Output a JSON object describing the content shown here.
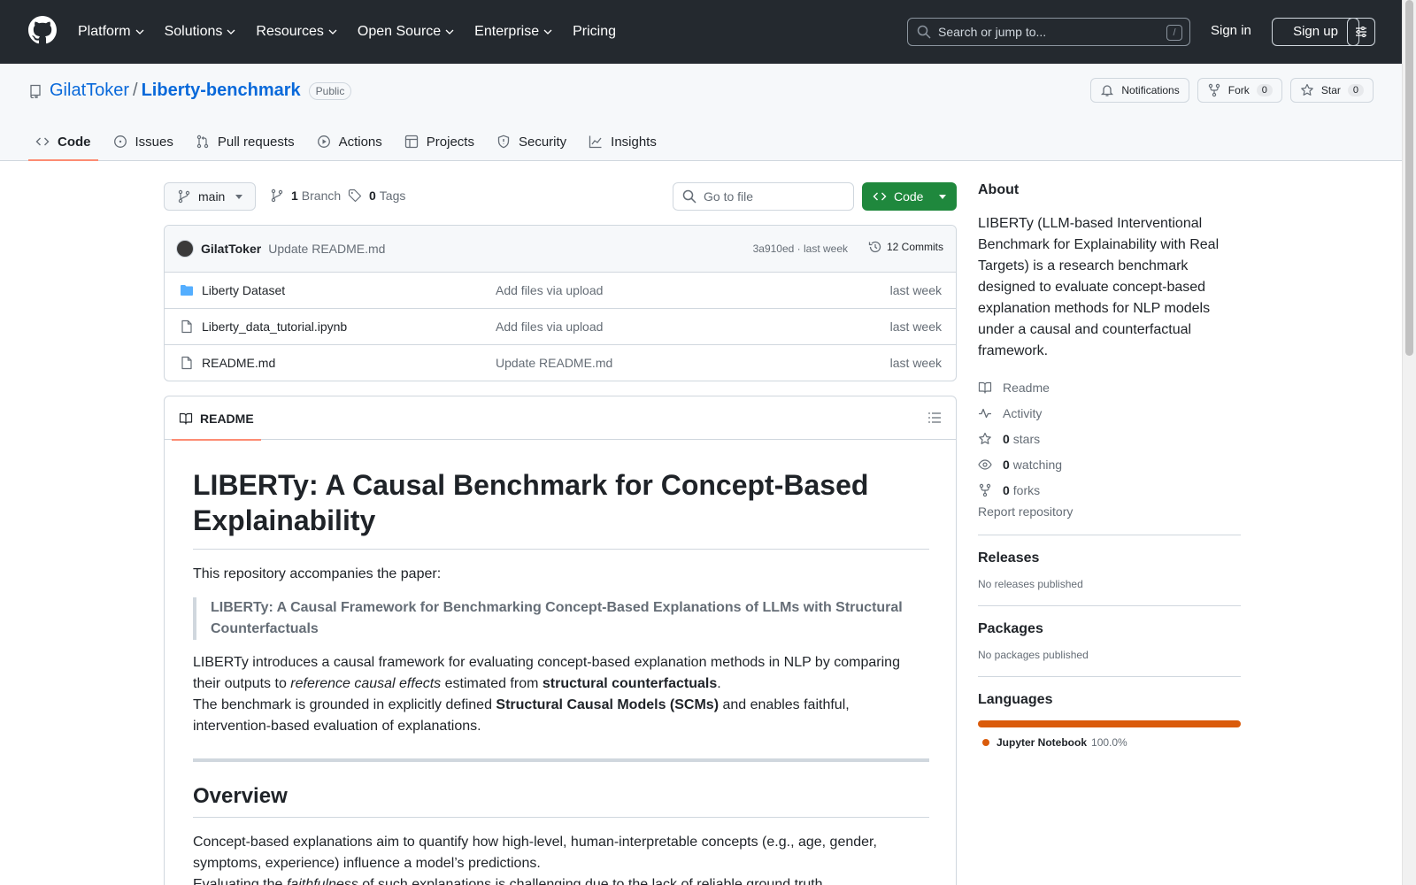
{
  "header": {
    "nav": [
      {
        "label": "Platform"
      },
      {
        "label": "Solutions"
      },
      {
        "label": "Resources"
      },
      {
        "label": "Open Source"
      },
      {
        "label": "Enterprise"
      },
      {
        "label": "Pricing"
      }
    ],
    "search_placeholder": "Search or jump to...",
    "search_shortcut": "/",
    "sign_in": "Sign in",
    "sign_up": "Sign up"
  },
  "repo": {
    "owner": "GilatToker",
    "separator": "/",
    "name": "Liberty-benchmark",
    "visibility": "Public",
    "notifications_label": "Notifications",
    "fork_label": "Fork",
    "fork_count": "0",
    "star_label": "Star",
    "star_count": "0",
    "tabs": [
      {
        "label": "Code"
      },
      {
        "label": "Issues"
      },
      {
        "label": "Pull requests"
      },
      {
        "label": "Actions"
      },
      {
        "label": "Projects"
      },
      {
        "label": "Security"
      },
      {
        "label": "Insights"
      }
    ]
  },
  "toolbar": {
    "branch": "main",
    "branch_count": "1",
    "branch_label": "Branch",
    "tag_count": "0",
    "tag_label": "Tags",
    "goto_placeholder": "Go to file",
    "code_label": "Code"
  },
  "commit": {
    "author": "GilatToker",
    "message": "Update README.md",
    "meta": "3a910ed · last week",
    "count_label": "12 Commits"
  },
  "files": [
    {
      "name": "Liberty Dataset",
      "message": "Add files via upload",
      "date": "last week",
      "type": "folder"
    },
    {
      "name": "Liberty_data_tutorial.ipynb",
      "message": "Add files via upload",
      "date": "last week",
      "type": "file"
    },
    {
      "name": "README.md",
      "message": "Update README.md",
      "date": "last week",
      "type": "file"
    }
  ],
  "readme": {
    "tab_label": "README",
    "title": "LIBERTy: A Causal Benchmark for Concept-Based Explainability",
    "intro": "This repository accompanies the paper:",
    "quote": "LIBERTy: A Causal Framework for Benchmarking Concept-Based Explanations of LLMs with Structural Counterfactuals",
    "p1_a": "LIBERTy introduces a causal framework for evaluating concept-based explanation methods in NLP by comparing their outputs to ",
    "p1_em": "reference causal effects",
    "p1_b": " estimated from ",
    "p1_strong": "structural counterfactuals",
    "p1_c": ".",
    "p2_a": "The benchmark is grounded in explicitly defined ",
    "p2_strong": "Structural Causal Models (SCMs)",
    "p2_b": " and enables faithful, intervention-based evaluation of explanations.",
    "h2": "Overview",
    "p3": "Concept-based explanations aim to quantify how high-level, human-interpretable concepts (e.g., age, gender, symptoms, experience) influence a model’s predictions.",
    "p4_a": "Evaluating the ",
    "p4_em": "faithfulness",
    "p4_b": " of such explanations is challenging due to the lack of reliable ground truth."
  },
  "sidebar": {
    "about_title": "About",
    "description": "LIBERTy (LLM-based Interventional Benchmark for Explainability with Real Targets) is a research benchmark designed to evaluate concept-based explanation methods for NLP models under a causal and counterfactual framework.",
    "readme_link": "Readme",
    "activity_link": "Activity",
    "stars_count": "0",
    "stars_label": "stars",
    "watching_count": "0",
    "watching_label": "watching",
    "forks_count": "0",
    "forks_label": "forks",
    "report": "Report repository",
    "releases_title": "Releases",
    "releases_empty": "No releases published",
    "packages_title": "Packages",
    "packages_empty": "No packages published",
    "languages_title": "Languages",
    "language_name": "Jupyter Notebook",
    "language_pct": "100.0%",
    "language_color": "#da5b0b"
  }
}
